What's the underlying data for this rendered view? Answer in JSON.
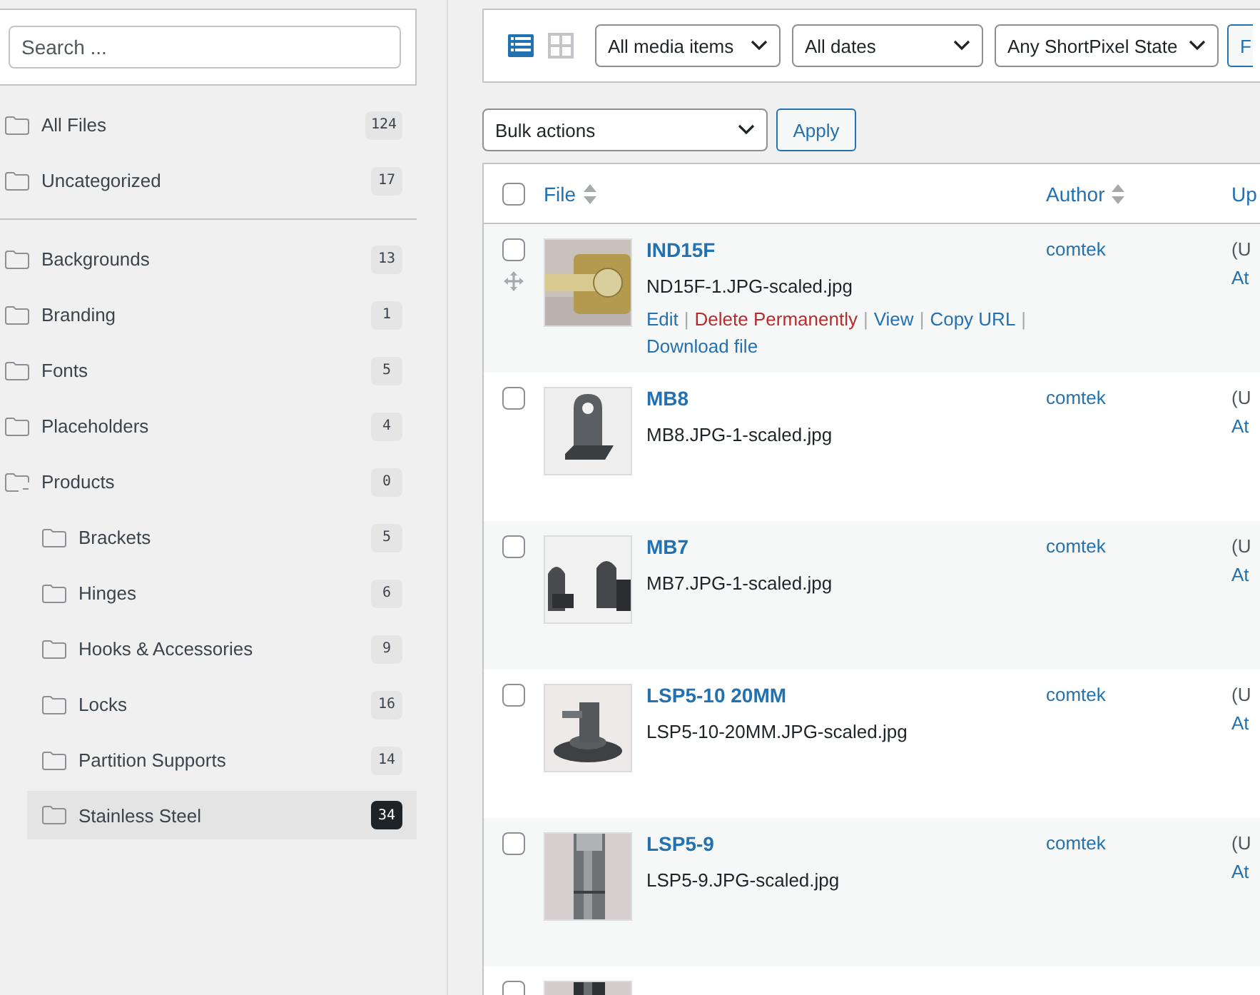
{
  "sidebar": {
    "search": {
      "placeholder": "Search ..."
    },
    "top_folders": [
      {
        "label": "All Files",
        "count": "124",
        "selected": false
      },
      {
        "label": "Uncategorized",
        "count": "17",
        "selected": false
      }
    ],
    "folders": [
      {
        "label": "Backgrounds",
        "count": "13",
        "selected": false,
        "expanded": false
      },
      {
        "label": "Branding",
        "count": "1",
        "selected": false,
        "expanded": false
      },
      {
        "label": "Fonts",
        "count": "5",
        "selected": false,
        "expanded": false
      },
      {
        "label": "Placeholders",
        "count": "4",
        "selected": false,
        "expanded": false
      },
      {
        "label": "Products",
        "count": "0",
        "selected": false,
        "expanded": true,
        "children": [
          {
            "label": "Brackets",
            "count": "5",
            "selected": false
          },
          {
            "label": "Hinges",
            "count": "6",
            "selected": false
          },
          {
            "label": "Hooks & Accessories",
            "count": "9",
            "selected": false
          },
          {
            "label": "Locks",
            "count": "16",
            "selected": false
          },
          {
            "label": "Partition Supports",
            "count": "14",
            "selected": false
          },
          {
            "label": "Stainless Steel",
            "count": "34",
            "selected": true
          }
        ]
      }
    ]
  },
  "toolbar": {
    "view_modes": [
      {
        "kind": "list",
        "selected": true
      },
      {
        "kind": "grid",
        "selected": false
      }
    ],
    "filters": [
      "All media items",
      "All dates",
      "Any ShortPixel State"
    ],
    "filter_button": "F"
  },
  "bulk": {
    "select": "Bulk actions",
    "apply": "Apply"
  },
  "table": {
    "select_all_checked": false,
    "partial_row": {
      "checked": false
    },
    "columns": [
      {
        "label": "File",
        "sortable": true
      },
      {
        "label": "Author",
        "sortable": true
      },
      {
        "label": "Up"
      }
    ],
    "rows": [
      {
        "title": "IND15F",
        "filename": "ND15F-1.JPG-scaled.jpg",
        "author": "comtek",
        "column_3": [
          "(U",
          "At"
        ],
        "checked": false,
        "draggable": true,
        "actions": [
          {
            "label": "Edit",
            "kind": "link",
            "separator": "|"
          },
          {
            "label": "Delete Permanently",
            "kind": "danger",
            "separator": "|"
          },
          {
            "label": "View",
            "kind": "link",
            "separator": "|"
          },
          {
            "label": "Copy URL",
            "kind": "link",
            "separator": "|"
          },
          {
            "label": "Download file",
            "kind": "link"
          }
        ]
      },
      {
        "title": "MB8",
        "filename": "MB8.JPG-1-scaled.jpg",
        "author": "comtek",
        "column_3": [
          "(U",
          "At"
        ],
        "checked": false,
        "draggable": false,
        "actions": []
      },
      {
        "title": "MB7",
        "filename": "MB7.JPG-1-scaled.jpg",
        "author": "comtek",
        "column_3": [
          "(U",
          "At"
        ],
        "checked": false,
        "draggable": false,
        "actions": []
      },
      {
        "title": "LSP5-10 20MM",
        "filename": "LSP5-10-20MM.JPG-scaled.jpg",
        "author": "comtek",
        "column_3": [
          "(U",
          "At"
        ],
        "checked": false,
        "draggable": false,
        "actions": []
      },
      {
        "title": "LSP5-9",
        "filename": "LSP5-9.JPG-scaled.jpg",
        "author": "comtek",
        "column_3": [
          "(U",
          "At"
        ],
        "checked": false,
        "draggable": false,
        "actions": []
      }
    ]
  }
}
